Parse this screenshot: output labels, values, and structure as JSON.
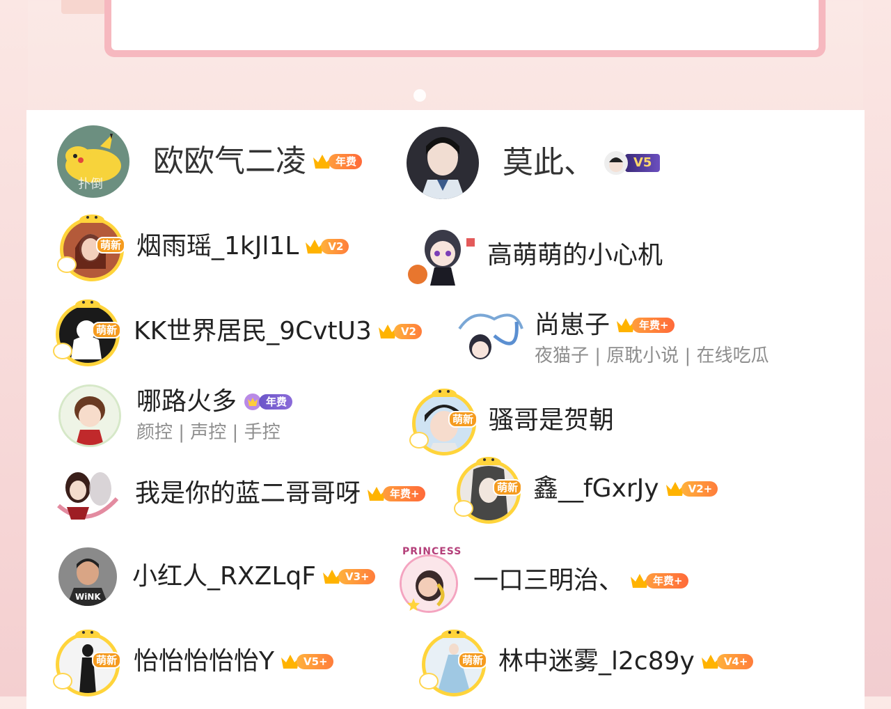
{
  "members": [
    {
      "name": "欧欧气二凌",
      "badge": "年费",
      "avatar_caption": "扑倒",
      "tags": ""
    },
    {
      "name": "莫此、",
      "badge": "V5",
      "tags": ""
    },
    {
      "name": "烟雨瑶_1kJl1L",
      "badge": "V2",
      "frame_tag": "萌新",
      "tags": ""
    },
    {
      "name": "高萌萌的小心机",
      "badge": "",
      "tags": ""
    },
    {
      "name": "KK世界居民_9CvtU3",
      "badge": "V2",
      "frame_tag": "萌新",
      "tags": ""
    },
    {
      "name": "尚崽子",
      "badge": "年费+",
      "tags": "夜猫子 | 原耽小说 | 在线吃瓜"
    },
    {
      "name": "哪路火多",
      "badge": "年费",
      "tags": "颜控 | 声控 | 手控"
    },
    {
      "name": "骚哥是贺朝",
      "badge": "",
      "frame_tag": "萌新",
      "tags": ""
    },
    {
      "name": "我是你的蓝二哥哥呀",
      "badge": "年费+",
      "tags": ""
    },
    {
      "name": "鑫__fGxrJy",
      "badge": "V2+",
      "frame_tag": "萌新",
      "tags": ""
    },
    {
      "name": "小红人_RXZLqF",
      "badge": "V3+",
      "avatar_caption": "WiNK",
      "tags": ""
    },
    {
      "name": "一口三明治、",
      "badge": "年费+",
      "avatar_caption": "PRINCESS",
      "tags": ""
    },
    {
      "name": "怡怡怡怡怡Y",
      "badge": "V5+",
      "frame_tag": "萌新",
      "tags": ""
    },
    {
      "name": "林中迷雾_l2c89y",
      "badge": "V4+",
      "frame_tag": "萌新",
      "tags": ""
    }
  ],
  "colors": {
    "crown": "#ffb300",
    "badge_orange": "#ff7a3b",
    "badge_purple": "#6b56c9",
    "frame_yellow": "#ffd43b",
    "tag_text": "#8e8e8e"
  }
}
